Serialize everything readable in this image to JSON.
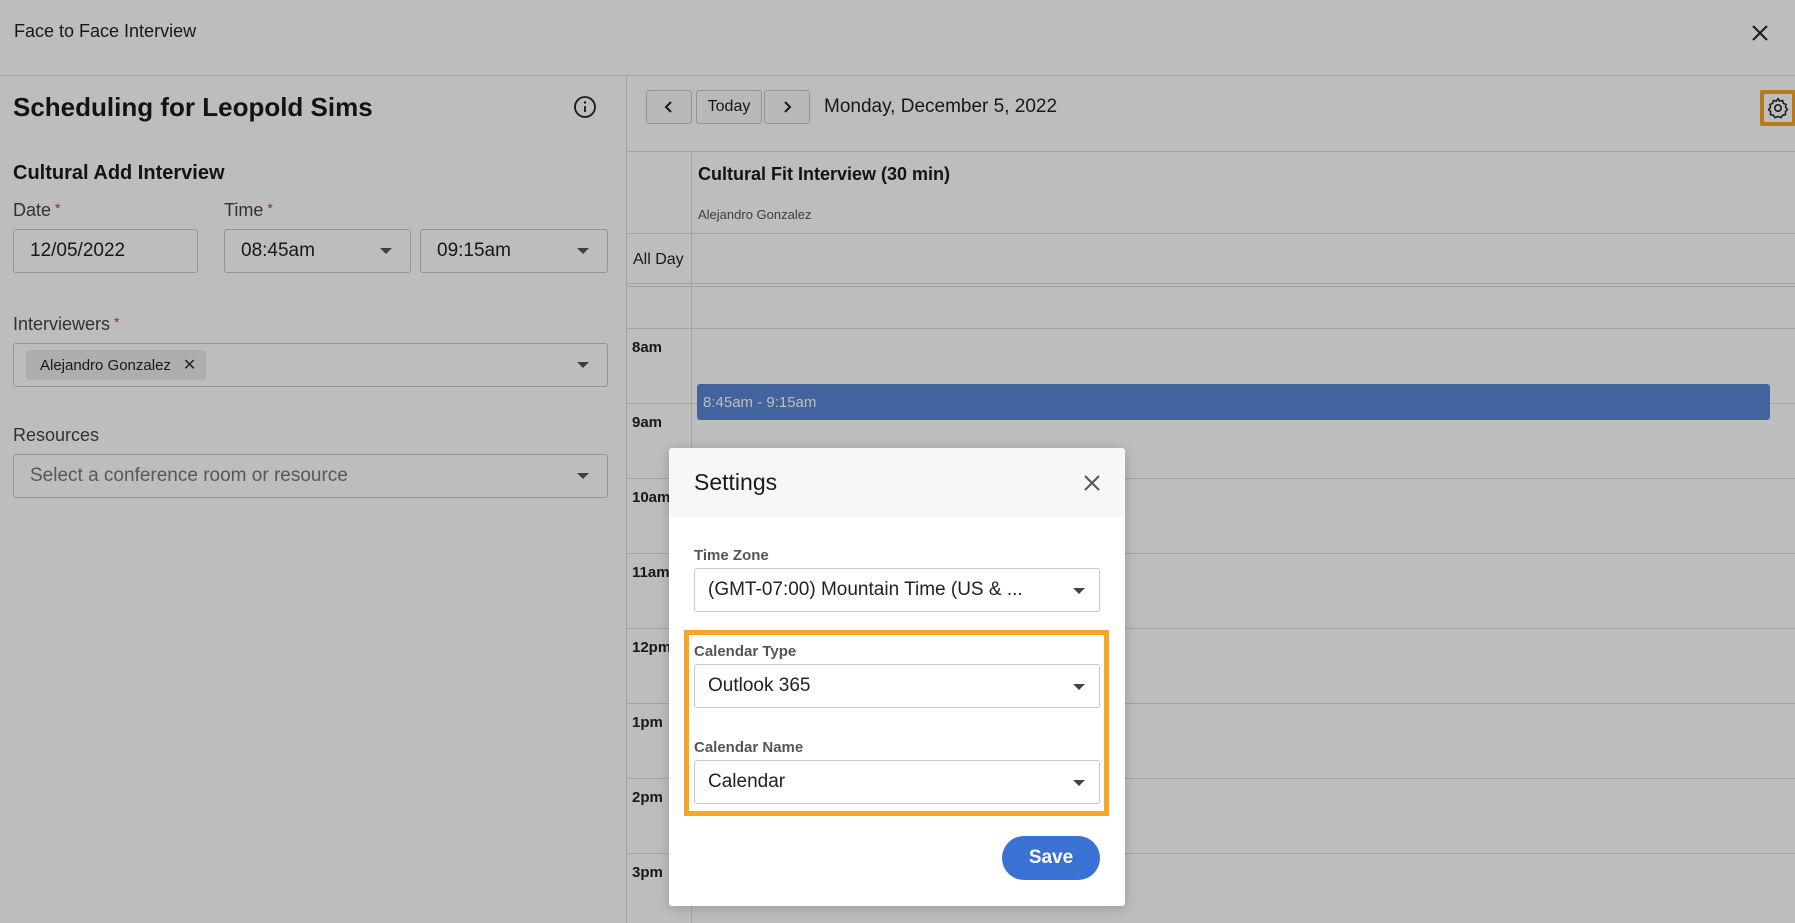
{
  "header": {
    "title": "Face to Face Interview"
  },
  "form": {
    "page_title": "Scheduling for Leopold Sims",
    "section_title": "Cultural Add Interview",
    "date_label": "Date",
    "time_label": "Time",
    "required_mark": "*",
    "date_value": "12/05/2022",
    "start_time": "08:45am",
    "end_time": "09:15am",
    "interviewers_label": "Interviewers",
    "interviewer_chip": "Alejandro Gonzalez",
    "chip_remove": "✕",
    "resources_label": "Resources",
    "resources_placeholder": "Select a conference room or resource"
  },
  "calendar": {
    "today_label": "Today",
    "date_display": "Monday, December 5, 2022",
    "column_title": "Cultural Fit Interview (30 min)",
    "column_subtitle": "Alejandro Gonzalez",
    "all_day_label": "All Day",
    "hours": [
      "8am",
      "9am",
      "10am",
      "11am",
      "12pm",
      "1pm",
      "2pm",
      "3pm"
    ],
    "event_label": "8:45am - 9:15am",
    "event_color": "#5b86d6"
  },
  "settings_modal": {
    "title": "Settings",
    "time_zone_label": "Time Zone",
    "time_zone_value": "(GMT-07:00) Mountain Time (US & ...",
    "calendar_type_label": "Calendar Type",
    "calendar_type_value": "Outlook 365",
    "calendar_name_label": "Calendar Name",
    "calendar_name_value": "Calendar",
    "save_label": "Save",
    "highlight_color": "#f5a623"
  }
}
